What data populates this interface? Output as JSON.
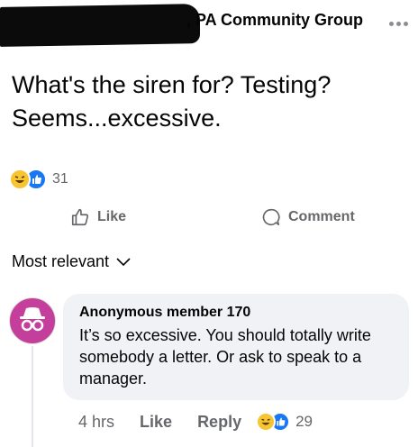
{
  "header": {
    "group_name": ", PA Community Group",
    "more_icon": "more-horizontal-icon"
  },
  "post": {
    "text": "What's the siren for? Testing? Seems...excessive.",
    "reaction_icons": [
      "haha-reaction-icon",
      "like-reaction-icon"
    ],
    "reaction_count": "31"
  },
  "actions": {
    "like_label": "Like",
    "comment_label": "Comment"
  },
  "sort": {
    "label": "Most relevant"
  },
  "comment": {
    "author": "Anonymous member 170",
    "text": "It’s so excessive. You should totally write somebody a letter. Or ask to speak to a manager.",
    "time": "4 hrs",
    "like_label": "Like",
    "reply_label": "Reply",
    "reaction_count": "29"
  },
  "colors": {
    "avatar": "#c43e9b",
    "like_blue": "#1877f2",
    "haha_yellow": "#f7c531",
    "secondary_text": "#65676b",
    "bubble_bg": "#f0f2f5"
  }
}
